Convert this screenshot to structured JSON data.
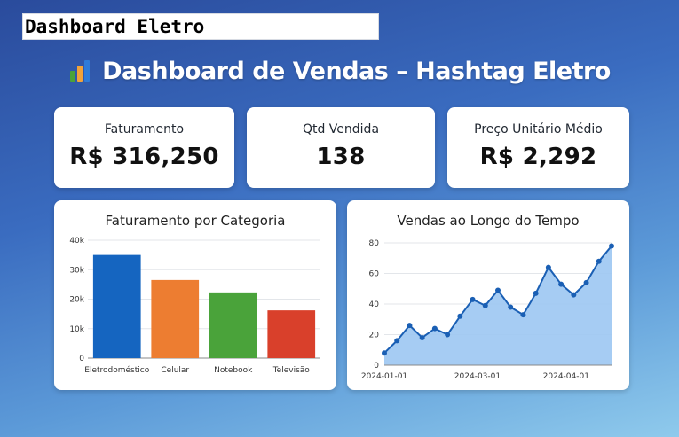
{
  "app": {
    "title": "Dashboard Eletro"
  },
  "header": {
    "title": "Dashboard de Vendas – Hashtag Eletro",
    "icon": "bar-chart-icon"
  },
  "kpis": [
    {
      "label": "Faturamento",
      "value": "R$ 316,250"
    },
    {
      "label": "Qtd Vendida",
      "value": "138"
    },
    {
      "label": "Preço Unitário Médio",
      "value": "R$ 2,292"
    }
  ],
  "colors": {
    "bar_colors": [
      "#1565c0",
      "#ed7d31",
      "#4aa33a",
      "#d9402b"
    ],
    "line": "#1a5fb4",
    "area": "#9cc6f2"
  },
  "chart_data": [
    {
      "type": "bar",
      "title": "Faturamento por Categoria",
      "categories": [
        "Eletrodoméstico",
        "Celular",
        "Notebook",
        "Televisão"
      ],
      "values": [
        35000,
        26500,
        22300,
        16200
      ],
      "ylim": [
        0,
        40000
      ],
      "yticks": [
        0,
        10000,
        20000,
        30000,
        40000
      ],
      "ytick_labels": [
        "0",
        "10k",
        "20k",
        "30k",
        "40k"
      ],
      "grid": true
    },
    {
      "type": "area",
      "title": "Vendas ao Longo do Tempo",
      "x": [
        "2024-01-01",
        "2024-01-08",
        "2024-01-15",
        "2024-01-22",
        "2024-01-29",
        "2024-02-05",
        "2024-02-12",
        "2024-02-19",
        "2024-02-26",
        "2024-03-04",
        "2024-03-11",
        "2024-03-18",
        "2024-03-25",
        "2024-04-01",
        "2024-04-08",
        "2024-04-15",
        "2024-04-22",
        "2024-04-29"
      ],
      "values": [
        8,
        16,
        26,
        18,
        24,
        20,
        32,
        43,
        39,
        49,
        38,
        33,
        47,
        64,
        53,
        46,
        54,
        68,
        78
      ],
      "ylim": [
        0,
        80
      ],
      "yticks": [
        0,
        20,
        40,
        60,
        80
      ],
      "xtick_labels": [
        "2024-01-01",
        "2024-03-01",
        "2024-04-01"
      ],
      "grid": true
    }
  ]
}
